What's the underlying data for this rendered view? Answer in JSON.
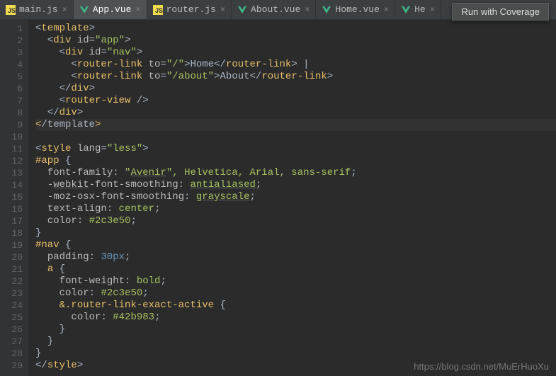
{
  "tabs": [
    {
      "label": "main.js",
      "type": "js",
      "active": false
    },
    {
      "label": "App.vue",
      "type": "vue",
      "active": true
    },
    {
      "label": "router.js",
      "type": "js",
      "active": false
    },
    {
      "label": "About.vue",
      "type": "vue",
      "active": false
    },
    {
      "label": "Home.vue",
      "type": "vue",
      "active": false
    },
    {
      "label": "He",
      "type": "vue",
      "active": false
    }
  ],
  "tooltip": "Run with Coverage",
  "watermark": "https://blog.csdn.net/MuErHuoXu",
  "code": {
    "lines": [
      {
        "n": 1,
        "indent": 0,
        "tokens": [
          [
            "punct",
            "<"
          ],
          [
            "tag",
            "template"
          ],
          [
            "punct",
            ">"
          ]
        ]
      },
      {
        "n": 2,
        "indent": 2,
        "tokens": [
          [
            "punct",
            "<"
          ],
          [
            "tag",
            "div "
          ],
          [
            "attr",
            "id"
          ],
          [
            "punct",
            "="
          ],
          [
            "val",
            "\"app\""
          ],
          [
            "punct",
            ">"
          ]
        ]
      },
      {
        "n": 3,
        "indent": 4,
        "tokens": [
          [
            "punct",
            "<"
          ],
          [
            "tag",
            "div "
          ],
          [
            "attr",
            "id"
          ],
          [
            "punct",
            "="
          ],
          [
            "val",
            "\"nav\""
          ],
          [
            "punct",
            ">"
          ]
        ]
      },
      {
        "n": 4,
        "indent": 6,
        "tokens": [
          [
            "punct",
            "<"
          ],
          [
            "tag",
            "router-link "
          ],
          [
            "attr",
            "to"
          ],
          [
            "punct",
            "="
          ],
          [
            "val",
            "\"/\""
          ],
          [
            "punct",
            ">"
          ],
          [
            "txt",
            "Home"
          ],
          [
            "punct",
            "</"
          ],
          [
            "tag",
            "router-link"
          ],
          [
            "punct",
            "> |"
          ]
        ]
      },
      {
        "n": 5,
        "indent": 6,
        "tokens": [
          [
            "punct",
            "<"
          ],
          [
            "tag",
            "router-link "
          ],
          [
            "attr",
            "to"
          ],
          [
            "punct",
            "="
          ],
          [
            "val",
            "\"/about\""
          ],
          [
            "punct",
            ">"
          ],
          [
            "txt",
            "About"
          ],
          [
            "punct",
            "</"
          ],
          [
            "tag",
            "router-link"
          ],
          [
            "punct",
            ">"
          ]
        ]
      },
      {
        "n": 6,
        "indent": 4,
        "tokens": [
          [
            "punct",
            "</"
          ],
          [
            "tag",
            "div"
          ],
          [
            "punct",
            ">"
          ]
        ]
      },
      {
        "n": 7,
        "indent": 4,
        "tokens": [
          [
            "punct",
            "<"
          ],
          [
            "tag",
            "router-view "
          ],
          [
            "punct",
            "/>"
          ]
        ]
      },
      {
        "n": 8,
        "indent": 2,
        "tokens": [
          [
            "punct",
            "</"
          ],
          [
            "tag",
            "div"
          ],
          [
            "punct",
            ">"
          ]
        ]
      },
      {
        "n": 9,
        "indent": 0,
        "hl": true,
        "tokens": [
          [
            "tag",
            "<"
          ],
          [
            "punct",
            "/template"
          ],
          [
            "tag",
            ">"
          ]
        ]
      },
      {
        "n": 10,
        "indent": 0,
        "tokens": []
      },
      {
        "n": 11,
        "indent": 0,
        "tokens": [
          [
            "punct",
            "<"
          ],
          [
            "tag",
            "style "
          ],
          [
            "attr",
            "lang"
          ],
          [
            "punct",
            "="
          ],
          [
            "val",
            "\"less\""
          ],
          [
            "punct",
            ">"
          ]
        ]
      },
      {
        "n": 12,
        "indent": 0,
        "tokens": [
          [
            "sel",
            "#app "
          ],
          [
            "punct",
            "{"
          ]
        ]
      },
      {
        "n": 13,
        "indent": 2,
        "tokens": [
          [
            "prop",
            "font-family"
          ],
          [
            "punct",
            ": "
          ],
          [
            "cval",
            "\""
          ],
          [
            "cval-u",
            "Avenir"
          ],
          [
            "cval",
            "\", Helvetica, Arial, sans-serif"
          ],
          [
            "punct",
            ";"
          ]
        ]
      },
      {
        "n": 14,
        "indent": 2,
        "tokens": [
          [
            "prop",
            "-"
          ],
          [
            "prop-u",
            "webkit"
          ],
          [
            "prop",
            "-font-smoothing"
          ],
          [
            "punct",
            ": "
          ],
          [
            "cval-u",
            "antialiased"
          ],
          [
            "punct",
            ";"
          ]
        ]
      },
      {
        "n": 15,
        "indent": 2,
        "tokens": [
          [
            "prop",
            "-moz-osx-font-smoothing"
          ],
          [
            "punct",
            ": "
          ],
          [
            "cval-u",
            "grayscale"
          ],
          [
            "punct",
            ";"
          ]
        ]
      },
      {
        "n": 16,
        "indent": 2,
        "tokens": [
          [
            "prop",
            "text-align"
          ],
          [
            "punct",
            ": "
          ],
          [
            "cval",
            "center"
          ],
          [
            "punct",
            ";"
          ]
        ]
      },
      {
        "n": 17,
        "indent": 2,
        "tokens": [
          [
            "prop",
            "color"
          ],
          [
            "punct",
            ": "
          ],
          [
            "cval",
            "#2c3e50"
          ],
          [
            "punct",
            ";"
          ]
        ]
      },
      {
        "n": 18,
        "indent": 0,
        "tokens": [
          [
            "punct",
            "}"
          ]
        ]
      },
      {
        "n": 19,
        "indent": 0,
        "tokens": [
          [
            "sel",
            "#nav "
          ],
          [
            "punct",
            "{"
          ]
        ]
      },
      {
        "n": 20,
        "indent": 2,
        "tokens": [
          [
            "prop",
            "padding"
          ],
          [
            "punct",
            ": "
          ],
          [
            "num",
            "30px"
          ],
          [
            "punct",
            ";"
          ]
        ]
      },
      {
        "n": 21,
        "indent": 2,
        "tokens": [
          [
            "sel",
            "a "
          ],
          [
            "punct",
            "{"
          ]
        ]
      },
      {
        "n": 22,
        "indent": 4,
        "tokens": [
          [
            "prop",
            "font-weight"
          ],
          [
            "punct",
            ": "
          ],
          [
            "cval",
            "bold"
          ],
          [
            "punct",
            ";"
          ]
        ]
      },
      {
        "n": 23,
        "indent": 4,
        "tokens": [
          [
            "prop",
            "color"
          ],
          [
            "punct",
            ": "
          ],
          [
            "cval",
            "#2c3e50"
          ],
          [
            "punct",
            ";"
          ]
        ]
      },
      {
        "n": 24,
        "indent": 4,
        "tokens": [
          [
            "sel",
            "&.router-link-exact-active "
          ],
          [
            "punct",
            "{"
          ]
        ]
      },
      {
        "n": 25,
        "indent": 6,
        "tokens": [
          [
            "prop",
            "color"
          ],
          [
            "punct",
            ": "
          ],
          [
            "cval",
            "#42b983"
          ],
          [
            "punct",
            ";"
          ]
        ]
      },
      {
        "n": 26,
        "indent": 4,
        "tokens": [
          [
            "punct",
            "}"
          ]
        ]
      },
      {
        "n": 27,
        "indent": 2,
        "tokens": [
          [
            "punct",
            "}"
          ]
        ]
      },
      {
        "n": 28,
        "indent": 0,
        "tokens": [
          [
            "punct",
            "}"
          ]
        ]
      },
      {
        "n": 29,
        "indent": 0,
        "tokens": [
          [
            "punct",
            "</"
          ],
          [
            "tag",
            "style"
          ],
          [
            "punct",
            ">"
          ]
        ]
      }
    ]
  }
}
